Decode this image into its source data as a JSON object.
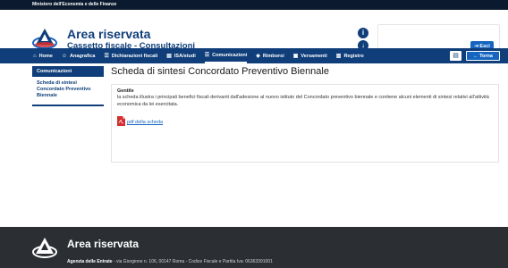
{
  "topbar": {
    "ministry": "Ministero dell'Economia e delle Finanze"
  },
  "header": {
    "title": "Area riservata",
    "subtitle": "Cassetto fiscale - Consultazioni",
    "info_icon": "info-icon",
    "download_icon": "download-icon",
    "exit_label": "Esci"
  },
  "nav": {
    "items": [
      {
        "label": "Home",
        "icon": "home-icon"
      },
      {
        "label": "Anagrafica",
        "icon": "user-icon"
      },
      {
        "label": "Dichiarazioni fiscali",
        "icon": "document-icon"
      },
      {
        "label": "ISA/studi",
        "icon": "chart-icon"
      },
      {
        "label": "Comunicazioni",
        "icon": "document-icon"
      },
      {
        "label": "Rimborsi",
        "icon": "refund-icon"
      },
      {
        "label": "Versamenti",
        "icon": "payment-icon"
      },
      {
        "label": "Registro",
        "icon": "register-icon"
      }
    ],
    "active_index": 4,
    "torna_label": "Torna"
  },
  "sidebar": {
    "heading": "Comunicazioni",
    "link": "Scheda di sintesi Concordato Preventivo Biennale"
  },
  "main": {
    "title": "Scheda di sintesi Concordato Preventivo Biennale",
    "greeting": "Gentile",
    "body": "la scheda illustra i principali benefici fiscali derivanti dall'adesione al nuovo istituto del Concordato preventivo biennale e contiene alcuni elementi di sintesi relativi all'attività economica da lei esercitata.",
    "pdf_link": "pdf della scheda"
  },
  "footer": {
    "title": "Area riservata",
    "agency": "Agenzia delle Entrate",
    "address": " - via Giorgione n. 106, 00147 Roma - Codice Fiscale e Partita Iva: 06363391001"
  },
  "colors": {
    "primary": "#0f3e7a",
    "accent": "#1565c0",
    "footer_bg": "#2b2f33",
    "pdf_red": "#d32f2f"
  }
}
